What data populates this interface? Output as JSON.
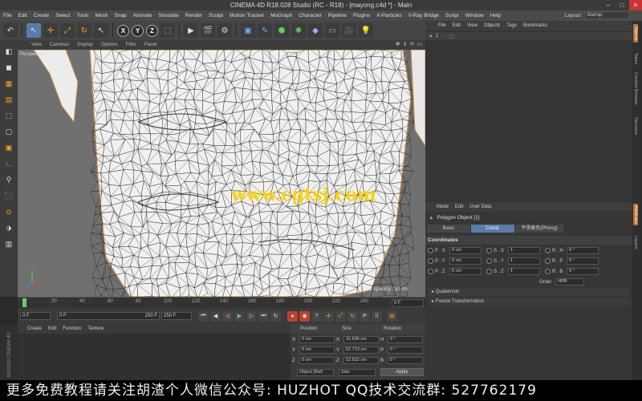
{
  "titlebar": {
    "title": "CINEMA 4D R18.028 Studio (RC - R18) - [mayong.c4d *] - Main",
    "min": "–",
    "max": "□",
    "close": "✕"
  },
  "menubar": {
    "items": [
      "File",
      "Edit",
      "Create",
      "Select",
      "Tools",
      "Mesh",
      "Snap",
      "Animate",
      "Simulate",
      "Render",
      "Sculpt",
      "Motion Tracker",
      "MoGraph",
      "Character",
      "Pipeline",
      "Plugins",
      "X-Particles",
      "V-Ray Bridge",
      "Script",
      "Window",
      "Help"
    ],
    "layout_label": "Layout:",
    "layout_value": "Startup"
  },
  "toolbar": {
    "undo": "↶",
    "select": "↖",
    "move": "✛",
    "scale": "⤢",
    "rotate": "↻",
    "live": "↖",
    "x": "X",
    "y": "Y",
    "z": "Z",
    "coord": "⬚",
    "render_view": "▶",
    "render": "🎬",
    "render_settings": "⚙",
    "cube": "▣",
    "pen": "✎",
    "subdiv": "⬢",
    "array": "✱",
    "deformer": "◆",
    "field": "▭",
    "camera": "🎥",
    "light": "💡"
  },
  "viewport": {
    "menu": [
      "View",
      "Cameras",
      "Display",
      "Options",
      "Filter",
      "Panel"
    ],
    "label": "Perspective",
    "watermark": "www.cgtsj.com",
    "grid_spacing": "Grid Spacing : 10 cm"
  },
  "timeline": {
    "ticks": [
      "0",
      "20",
      "40",
      "60",
      "80",
      "100",
      "120",
      "140",
      "160",
      "180",
      "200",
      "220",
      "240"
    ],
    "end_field": "0 F"
  },
  "playback": {
    "start": "0 F",
    "current": "0 F",
    "end_range": "250 F",
    "end": "250 F"
  },
  "material": {
    "menu": [
      "Create",
      "Edit",
      "Function",
      "Texture"
    ],
    "logo": "MAXON CINEMA 4D"
  },
  "coordinates": {
    "headers": [
      "Position",
      "Size",
      "Rotation"
    ],
    "rows": [
      {
        "axis": "X",
        "pos": "0 cm",
        "size_axis": "X",
        "size": "15.606 cm",
        "rot_axis": "H",
        "rot": "0 °"
      },
      {
        "axis": "Y",
        "pos": "0 cm",
        "size_axis": "Y",
        "size": "52.713 cm",
        "rot_axis": "P",
        "rot": "0 °"
      },
      {
        "axis": "Z",
        "pos": "0 cm",
        "size_axis": "Z",
        "size": "12.622 cm",
        "rot_axis": "B",
        "rot": "0 °"
      }
    ],
    "mode": "Object (Rel)",
    "size_mode": "Size",
    "apply": "Apply"
  },
  "objects": {
    "menu": [
      "File",
      "Edit",
      "View",
      "Objects",
      "Tags",
      "Bookmarks"
    ],
    "row_index": "1"
  },
  "attributes": {
    "menu": [
      "Mode",
      "Edit",
      "User Data"
    ],
    "title": "Polygon Object [1]",
    "tabs": [
      "Basic",
      "Coord.",
      "平滑着色(Phong)"
    ],
    "section": "Coordinates",
    "rows": [
      {
        "l1": "P . X",
        "v1": "0 cm",
        "l2": "S . X",
        "v2": "1",
        "l3": "R . H",
        "v3": "0 °"
      },
      {
        "l1": "P . Y",
        "v1": "0 cm",
        "l2": "S . Y",
        "v2": "1",
        "l3": "R . P",
        "v3": "0 °"
      },
      {
        "l1": "P . Z",
        "v1": "0 cm",
        "l2": "S . Z",
        "v2": "1",
        "l3": "R . B",
        "v3": "0 °"
      }
    ],
    "order_label": "Order",
    "order_value": "HPB",
    "quaternion": "Quaternion",
    "freeze": "Freeze Transformation"
  },
  "sidetabs": [
    "Objects",
    "Takes",
    "Content Browser",
    "Structure",
    "Attributes",
    "Layers"
  ],
  "banner": "更多免费教程请关注胡渣个人微信公众号:  HUZHOT  QQ技术交流群:  527762179"
}
